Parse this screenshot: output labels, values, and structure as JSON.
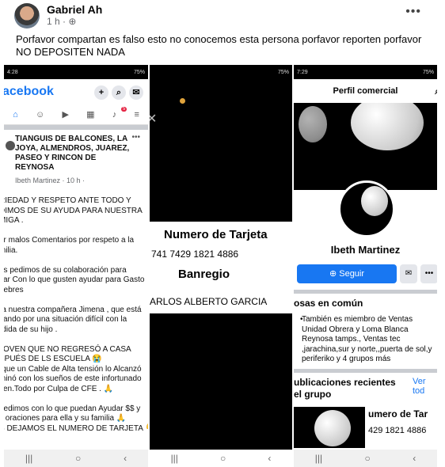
{
  "post": {
    "author": "Gabriel Ah",
    "time": "1 h · ",
    "text": "Porfavor compartan es falso esto no conocemos esta persona porfavor reporten porfavor NO DEPOSITEN NADA"
  },
  "phone1": {
    "status_time": "4:28",
    "status_right": "75%",
    "logo": "acebook",
    "badge": "5",
    "group_name": "TIANGUIS DE BALCONES, LA JOYA, ALMENDROS, JUAREZ, PASEO Y RINCON DE REYNOSA",
    "group_meta": "Ibeth Martinez · 10 h ·",
    "body": "RIEDAD Y RESPETO ANTE TODO Y\nDIMOS DE SU AYUDA PARA NUESTRA\nMIGA .\n\nor malos Comentarios por respeto a la\nmilia.\n\nes pedimos de su colaboración para\nyar Con lo que gusten ayudar para Gasto\nnebres\n\nra nuestra compañera Jimena , que está\nsando por una situación difícil con la\nrdida de su hijo .\n\n JOVEN QUE NO REGRESÓ A CASA\nSPUÉS DE LS ESCUELA 😭\nrque un Cable de Alta tensión lo Alcanzó\nminó con los sueños de este infortunado\nven.Todo por Culpa de CFE . 🙏\n\npedimos con lo que puedan Ayudar $$ y\ns oraciones para ella y su familia 🙏\nS DEJAMOS EL NUMERO DE TARJETA 👇"
  },
  "phone2": {
    "status_right": "75%",
    "card_title": "Numero de Tarjeta",
    "card_number": "741 7429 1821 4886",
    "bank": "Banregio",
    "holder": "ARLOS ALBERTO GARCIA"
  },
  "phone3": {
    "status_time": "7:29",
    "status_right": "75%",
    "header": "Perfil comercial",
    "name": "Ibeth Martinez",
    "follow_label": "Seguir",
    "common_title": "osas en común",
    "common_text": "También es miembro de Ventas Unidad Obrera y Loma Blanca Reynosa tamps., Ventas tec ,jarachina,sur y norte,,puerta de sol,y periferiko y 4 grupos más",
    "recent_title": "ublicaciones recientes el grupo",
    "see_all": "Ver tod",
    "thumb_text": "umero de Tar",
    "thumb_num": "429 1821 4886"
  }
}
